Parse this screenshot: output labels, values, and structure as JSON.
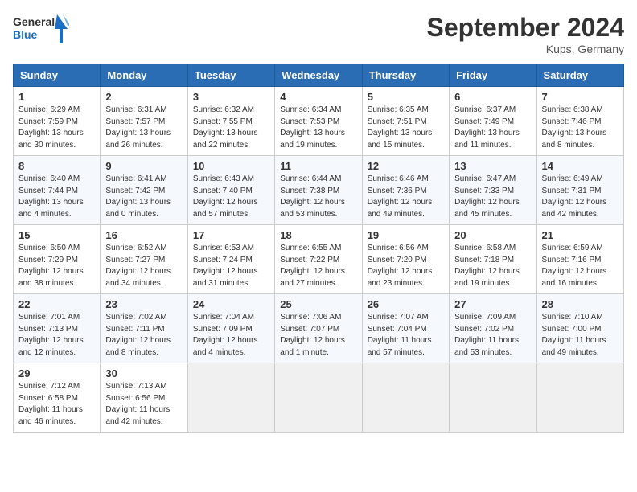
{
  "header": {
    "logo_general": "General",
    "logo_blue": "Blue",
    "month_year": "September 2024",
    "location": "Kups, Germany"
  },
  "weekdays": [
    "Sunday",
    "Monday",
    "Tuesday",
    "Wednesday",
    "Thursday",
    "Friday",
    "Saturday"
  ],
  "weeks": [
    [
      {
        "day": "1",
        "lines": [
          "Sunrise: 6:29 AM",
          "Sunset: 7:59 PM",
          "Daylight: 13 hours",
          "and 30 minutes."
        ]
      },
      {
        "day": "2",
        "lines": [
          "Sunrise: 6:31 AM",
          "Sunset: 7:57 PM",
          "Daylight: 13 hours",
          "and 26 minutes."
        ]
      },
      {
        "day": "3",
        "lines": [
          "Sunrise: 6:32 AM",
          "Sunset: 7:55 PM",
          "Daylight: 13 hours",
          "and 22 minutes."
        ]
      },
      {
        "day": "4",
        "lines": [
          "Sunrise: 6:34 AM",
          "Sunset: 7:53 PM",
          "Daylight: 13 hours",
          "and 19 minutes."
        ]
      },
      {
        "day": "5",
        "lines": [
          "Sunrise: 6:35 AM",
          "Sunset: 7:51 PM",
          "Daylight: 13 hours",
          "and 15 minutes."
        ]
      },
      {
        "day": "6",
        "lines": [
          "Sunrise: 6:37 AM",
          "Sunset: 7:49 PM",
          "Daylight: 13 hours",
          "and 11 minutes."
        ]
      },
      {
        "day": "7",
        "lines": [
          "Sunrise: 6:38 AM",
          "Sunset: 7:46 PM",
          "Daylight: 13 hours",
          "and 8 minutes."
        ]
      }
    ],
    [
      {
        "day": "8",
        "lines": [
          "Sunrise: 6:40 AM",
          "Sunset: 7:44 PM",
          "Daylight: 13 hours",
          "and 4 minutes."
        ]
      },
      {
        "day": "9",
        "lines": [
          "Sunrise: 6:41 AM",
          "Sunset: 7:42 PM",
          "Daylight: 13 hours",
          "and 0 minutes."
        ]
      },
      {
        "day": "10",
        "lines": [
          "Sunrise: 6:43 AM",
          "Sunset: 7:40 PM",
          "Daylight: 12 hours",
          "and 57 minutes."
        ]
      },
      {
        "day": "11",
        "lines": [
          "Sunrise: 6:44 AM",
          "Sunset: 7:38 PM",
          "Daylight: 12 hours",
          "and 53 minutes."
        ]
      },
      {
        "day": "12",
        "lines": [
          "Sunrise: 6:46 AM",
          "Sunset: 7:36 PM",
          "Daylight: 12 hours",
          "and 49 minutes."
        ]
      },
      {
        "day": "13",
        "lines": [
          "Sunrise: 6:47 AM",
          "Sunset: 7:33 PM",
          "Daylight: 12 hours",
          "and 45 minutes."
        ]
      },
      {
        "day": "14",
        "lines": [
          "Sunrise: 6:49 AM",
          "Sunset: 7:31 PM",
          "Daylight: 12 hours",
          "and 42 minutes."
        ]
      }
    ],
    [
      {
        "day": "15",
        "lines": [
          "Sunrise: 6:50 AM",
          "Sunset: 7:29 PM",
          "Daylight: 12 hours",
          "and 38 minutes."
        ]
      },
      {
        "day": "16",
        "lines": [
          "Sunrise: 6:52 AM",
          "Sunset: 7:27 PM",
          "Daylight: 12 hours",
          "and 34 minutes."
        ]
      },
      {
        "day": "17",
        "lines": [
          "Sunrise: 6:53 AM",
          "Sunset: 7:24 PM",
          "Daylight: 12 hours",
          "and 31 minutes."
        ]
      },
      {
        "day": "18",
        "lines": [
          "Sunrise: 6:55 AM",
          "Sunset: 7:22 PM",
          "Daylight: 12 hours",
          "and 27 minutes."
        ]
      },
      {
        "day": "19",
        "lines": [
          "Sunrise: 6:56 AM",
          "Sunset: 7:20 PM",
          "Daylight: 12 hours",
          "and 23 minutes."
        ]
      },
      {
        "day": "20",
        "lines": [
          "Sunrise: 6:58 AM",
          "Sunset: 7:18 PM",
          "Daylight: 12 hours",
          "and 19 minutes."
        ]
      },
      {
        "day": "21",
        "lines": [
          "Sunrise: 6:59 AM",
          "Sunset: 7:16 PM",
          "Daylight: 12 hours",
          "and 16 minutes."
        ]
      }
    ],
    [
      {
        "day": "22",
        "lines": [
          "Sunrise: 7:01 AM",
          "Sunset: 7:13 PM",
          "Daylight: 12 hours",
          "and 12 minutes."
        ]
      },
      {
        "day": "23",
        "lines": [
          "Sunrise: 7:02 AM",
          "Sunset: 7:11 PM",
          "Daylight: 12 hours",
          "and 8 minutes."
        ]
      },
      {
        "day": "24",
        "lines": [
          "Sunrise: 7:04 AM",
          "Sunset: 7:09 PM",
          "Daylight: 12 hours",
          "and 4 minutes."
        ]
      },
      {
        "day": "25",
        "lines": [
          "Sunrise: 7:06 AM",
          "Sunset: 7:07 PM",
          "Daylight: 12 hours",
          "and 1 minute."
        ]
      },
      {
        "day": "26",
        "lines": [
          "Sunrise: 7:07 AM",
          "Sunset: 7:04 PM",
          "Daylight: 11 hours",
          "and 57 minutes."
        ]
      },
      {
        "day": "27",
        "lines": [
          "Sunrise: 7:09 AM",
          "Sunset: 7:02 PM",
          "Daylight: 11 hours",
          "and 53 minutes."
        ]
      },
      {
        "day": "28",
        "lines": [
          "Sunrise: 7:10 AM",
          "Sunset: 7:00 PM",
          "Daylight: 11 hours",
          "and 49 minutes."
        ]
      }
    ],
    [
      {
        "day": "29",
        "lines": [
          "Sunrise: 7:12 AM",
          "Sunset: 6:58 PM",
          "Daylight: 11 hours",
          "and 46 minutes."
        ]
      },
      {
        "day": "30",
        "lines": [
          "Sunrise: 7:13 AM",
          "Sunset: 6:56 PM",
          "Daylight: 11 hours",
          "and 42 minutes."
        ]
      },
      {
        "day": "",
        "lines": []
      },
      {
        "day": "",
        "lines": []
      },
      {
        "day": "",
        "lines": []
      },
      {
        "day": "",
        "lines": []
      },
      {
        "day": "",
        "lines": []
      }
    ]
  ]
}
